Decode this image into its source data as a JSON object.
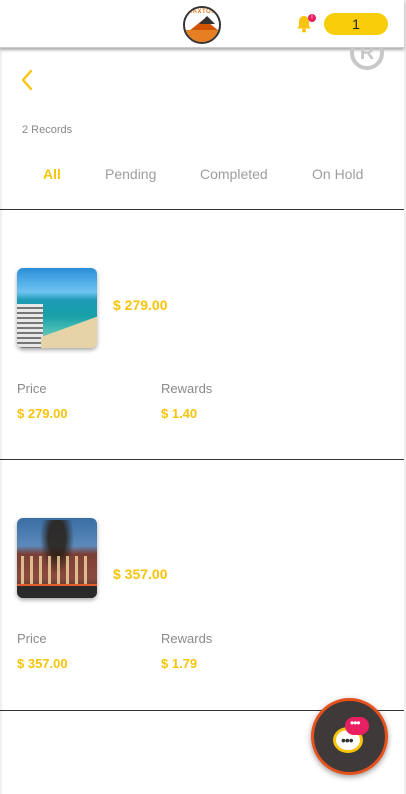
{
  "header": {
    "logo_text": "MAXTOUR",
    "notification_count": "!",
    "cart_count": "1"
  },
  "nav": {
    "back_icon": "chevron-left-icon"
  },
  "records_label": "2 Records",
  "tabs": [
    {
      "label": "All",
      "active": true
    },
    {
      "label": "Pending",
      "active": false
    },
    {
      "label": "Completed",
      "active": false
    },
    {
      "label": "On Hold",
      "active": false
    }
  ],
  "records": [
    {
      "amount": "$ 279.00",
      "price_label": "Price",
      "price_value": "$ 279.00",
      "rewards_label": "Rewards",
      "rewards_value": "$ 1.40"
    },
    {
      "amount": "$ 357.00",
      "price_label": "Price",
      "price_value": "$ 357.00",
      "rewards_label": "Rewards",
      "rewards_value": "$ 1.79"
    }
  ],
  "colors": {
    "accent": "#f7c40b",
    "badge": "#e91e63",
    "fab_border": "#e6511c"
  }
}
